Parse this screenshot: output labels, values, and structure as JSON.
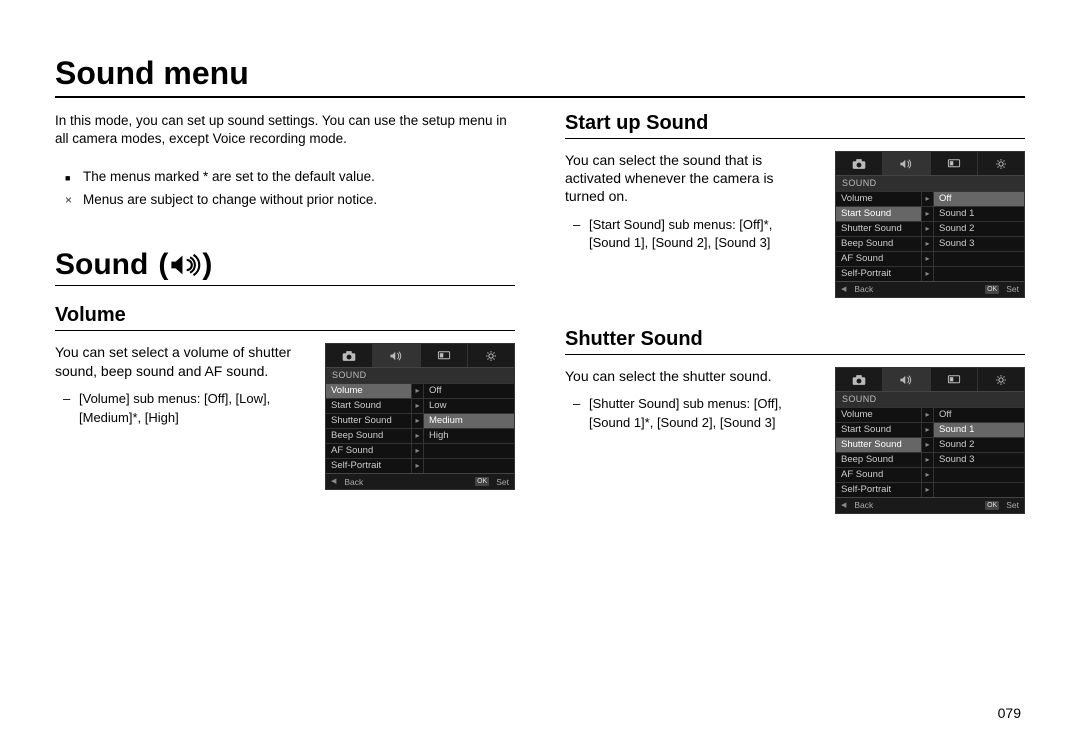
{
  "page": {
    "title": "Sound menu",
    "intro": "In this mode, you can set up sound settings. You can use the setup menu in all camera modes, except Voice recording mode.",
    "notes": [
      {
        "marker": "square",
        "text": "The menus marked * are set to the default value."
      },
      {
        "marker": "exmark",
        "text": "Menus are subject to change without prior notice."
      }
    ],
    "pagenum": "079"
  },
  "sound_section": {
    "title": "Sound",
    "icon": "sound-icon"
  },
  "volume": {
    "title": "Volume",
    "desc": "You can set select a volume of shutter sound, beep sound and AF sound.",
    "sub_label": "[Volume] sub menus: [Off], [Low], [Medium]*, [High]",
    "menu": {
      "section": "SOUND",
      "highlight_label": "Volume",
      "highlight_opt_row": 2,
      "rows": [
        {
          "label": "Volume",
          "opt": "Off"
        },
        {
          "label": "Start Sound",
          "opt": "Low"
        },
        {
          "label": "Shutter Sound",
          "opt": "Medium"
        },
        {
          "label": "Beep Sound",
          "opt": "High"
        },
        {
          "label": "AF Sound",
          "opt": ""
        },
        {
          "label": "Self-Portrait",
          "opt": ""
        }
      ],
      "foot": {
        "back": "Back",
        "set": "Set"
      }
    }
  },
  "startup": {
    "title": "Start up Sound",
    "desc": "You can select the sound that is activated whenever the camera is turned on.",
    "sub_label": "[Start Sound] sub menus: [Off]*, [Sound 1], [Sound 2], [Sound 3]",
    "menu": {
      "section": "SOUND",
      "highlight_label": "Start Sound",
      "highlight_opt_row": 0,
      "rows": [
        {
          "label": "Volume",
          "opt": "Off"
        },
        {
          "label": "Start Sound",
          "opt": "Sound 1"
        },
        {
          "label": "Shutter Sound",
          "opt": "Sound 2"
        },
        {
          "label": "Beep Sound",
          "opt": "Sound 3"
        },
        {
          "label": "AF Sound",
          "opt": ""
        },
        {
          "label": "Self-Portrait",
          "opt": ""
        }
      ],
      "foot": {
        "back": "Back",
        "set": "Set"
      }
    }
  },
  "shutter": {
    "title": "Shutter Sound",
    "desc": "You can select the shutter sound.",
    "sub_label": "[Shutter Sound] sub menus: [Off], [Sound 1]*, [Sound 2], [Sound 3]",
    "menu": {
      "section": "SOUND",
      "highlight_label": "Shutter Sound",
      "highlight_opt_row": 1,
      "rows": [
        {
          "label": "Volume",
          "opt": "Off"
        },
        {
          "label": "Start Sound",
          "opt": "Sound 1"
        },
        {
          "label": "Shutter Sound",
          "opt": "Sound 2"
        },
        {
          "label": "Beep Sound",
          "opt": "Sound 3"
        },
        {
          "label": "AF Sound",
          "opt": ""
        },
        {
          "label": "Self-Portrait",
          "opt": ""
        }
      ],
      "foot": {
        "back": "Back",
        "set": "Set"
      }
    }
  }
}
